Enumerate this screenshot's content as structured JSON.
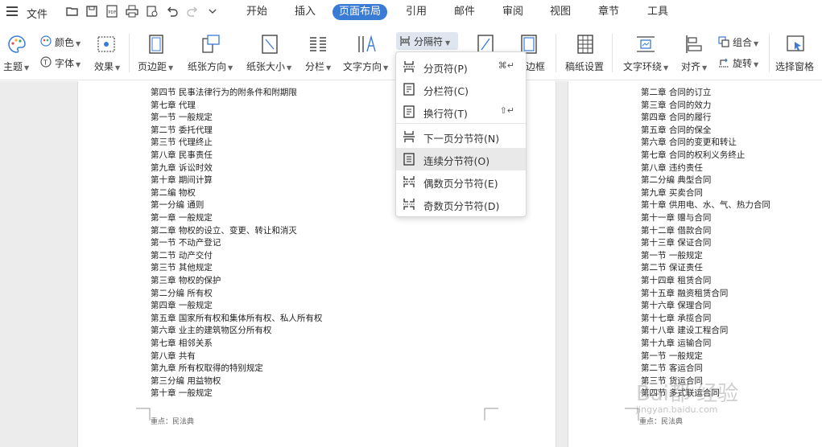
{
  "menubar": {
    "file_label": "文件",
    "tabs": [
      {
        "label": "开始"
      },
      {
        "label": "插入"
      },
      {
        "label": "页面布局"
      },
      {
        "label": "引用"
      },
      {
        "label": "邮件"
      },
      {
        "label": "审阅"
      },
      {
        "label": "视图"
      },
      {
        "label": "章节"
      },
      {
        "label": "工具"
      }
    ],
    "active_tab": "页面布局",
    "accent_color": "#3a7bd5"
  },
  "ribbon": {
    "theme": "主题",
    "color": "颜色",
    "font": "字体",
    "effect": "效果",
    "margin": "页边距",
    "orientation": "纸张方向",
    "size": "纸张大小",
    "columns": "分栏",
    "text_direction": "文字方向",
    "separator": "分隔符",
    "page_border_partial": "边框",
    "manuscript": "稿纸设置",
    "wrap": "文字环绕",
    "align": "对齐",
    "group": "组合",
    "rotate": "旋转",
    "selection_pane": "选择窗格"
  },
  "dropdown": {
    "items": [
      {
        "label": "分页符(P)",
        "shortcut": "⌘↵",
        "icon": "page-break-icon"
      },
      {
        "label": "分栏符(C)",
        "shortcut": "",
        "icon": "column-break-icon"
      },
      {
        "label": "换行符(T)",
        "shortcut": "⇧↵",
        "icon": "line-break-icon"
      },
      {
        "label": "下一页分节符(N)",
        "shortcut": "",
        "icon": "next-page-section-icon"
      },
      {
        "label": "连续分节符(O)",
        "shortcut": "",
        "icon": "continuous-section-icon"
      },
      {
        "label": "偶数页分节符(E)",
        "shortcut": "",
        "icon": "even-page-section-icon"
      },
      {
        "label": "奇数页分节符(D)",
        "shortcut": "",
        "icon": "odd-page-section-icon"
      }
    ],
    "highlighted_item": "连续分节符(O)"
  },
  "left_page": {
    "lines": [
      "第四节 民事法律行为的附条件和附期限",
      "第七章 代理",
      "第一节 一般规定",
      "第二节 委托代理",
      "第三节 代理终止",
      "第八章 民事责任",
      "第九章 诉讼时效",
      "第十章 期间计算",
      "第二编 物权",
      "第一分编 通则",
      "第一章 一般规定",
      "第二章 物权的设立、变更、转让和消灭",
      "第一节 不动产登记",
      "第二节 动产交付",
      "第三节 其他规定",
      "第三章 物权的保护",
      "第二分编 所有权",
      "第四章 一般规定",
      "第五章 国家所有权和集体所有权、私人所有权",
      "第六章 业主的建筑物区分所有权",
      "第七章 相邻关系",
      "第八章 共有",
      "第九章 所有权取得的特别规定",
      "第三分编 用益物权",
      "第十章 一般规定"
    ],
    "footer": "重点：民法典"
  },
  "right_page": {
    "lines": [
      "第二章 合同的订立",
      "第三章 合同的效力",
      "第四章 合同的履行",
      "第五章 合同的保全",
      "第六章 合同的变更和转让",
      "第七章 合同的权利义务终止",
      "第八章 违约责任",
      "第二分编 典型合同",
      "第九章 买卖合同",
      "第十章 供用电、水、气、热力合同",
      "第十一章 赠与合同",
      "第十二章 借款合同",
      "第十三章 保证合同",
      "第一节 一般规定",
      "第二节 保证责任",
      "第十四章 租赁合同",
      "第十五章 融资租赁合同",
      "第十六章 保理合同",
      "第十七章 承揽合同",
      "第十八章 建设工程合同",
      "第十九章 运输合同",
      "第一节 一般规定",
      "第二节 客运合同",
      "第三节 货运合同",
      "第四节 多式联运合同"
    ],
    "footer": "重点：民法典"
  },
  "watermark": {
    "text": "Bai都 经验",
    "url": "jingyan.baidu.com"
  }
}
